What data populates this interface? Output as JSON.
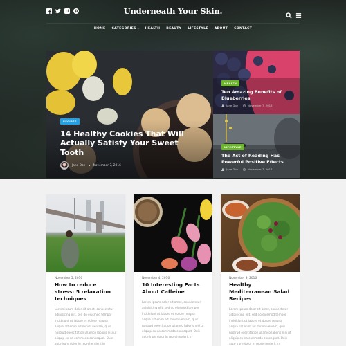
{
  "header": {
    "logo": "Underneath Your Skin.",
    "social": [
      "facebook-icon",
      "twitter-icon",
      "instagram-icon",
      "pinterest-icon"
    ],
    "right_icons": [
      "search-icon",
      "menu-icon"
    ]
  },
  "nav": {
    "items": [
      {
        "label": "HOME",
        "has_dropdown": false
      },
      {
        "label": "CATEGORIES",
        "has_dropdown": true
      },
      {
        "label": "HEALTH",
        "has_dropdown": false
      },
      {
        "label": "BEAUTY",
        "has_dropdown": false
      },
      {
        "label": "LIFESTYLE",
        "has_dropdown": false
      },
      {
        "label": "ABOUT",
        "has_dropdown": false
      },
      {
        "label": "CONTACT",
        "has_dropdown": false
      }
    ]
  },
  "featured": {
    "main": {
      "category": "RECIPES",
      "category_color": "#1fa3e8",
      "title": "14 Healthy Cookies That Will Actually Satisfy Your Sweet Tooth",
      "author": "Jane Doe",
      "date": "November 7, 2016"
    },
    "side": [
      {
        "category": "HEALTH",
        "category_color": "#6cb52d",
        "title": "Ten Amazing Benefits of Blueberries",
        "author": "Jane Doe",
        "date": "November 7, 2016"
      },
      {
        "category": "LIFESTYLE",
        "category_color": "#6cb52d",
        "title": "The Act of Reading Has Powerful Positive Effects",
        "author": "Jane Doe",
        "date": "November 7, 2016"
      }
    ]
  },
  "cards": [
    {
      "date": "November 5, 2016",
      "title": "How to reduce stress: 5 relaxation techniques",
      "excerpt": "Lorem ipsum dolor sit amet, consectetur adipisicing elit, sed do eiusmod tempor incididunt ut labore et dolore magna aliqua. Ut enim ad minim veniam, quis nostrud exercitation ullamco laboris nisi ut aliquip ex ea commodo consequat. Duis aute irure dolor in reprehenderit in"
    },
    {
      "date": "November 4, 2016",
      "title": "10 Interesting Facts About Caffeine",
      "excerpt": "Lorem ipsum dolor sit amet, consectetur adipisicing elit, sed do eiusmod tempor incididunt ut labore et dolore magna aliqua. Ut enim ad minim veniam, quis nostrud exercitation ullamco laboris nisi ut aliquip ex ea commodo consequat. Duis aute irure dolor in reprehenderit in"
    },
    {
      "date": "November 3, 2016",
      "title": "Healthy Mediterranean Salad Recipes",
      "excerpt": "Lorem ipsum dolor sit amet, consectetur adipisicing elit, sed do eiusmod tempor incididunt ut labore et dolore magna aliqua. Ut enim ad minim veniam, quis nostrud exercitation ullamco laboris nisi ut aliquip ex ea commodo consequat. Duis aute irure dolor in reprehenderit in"
    }
  ]
}
